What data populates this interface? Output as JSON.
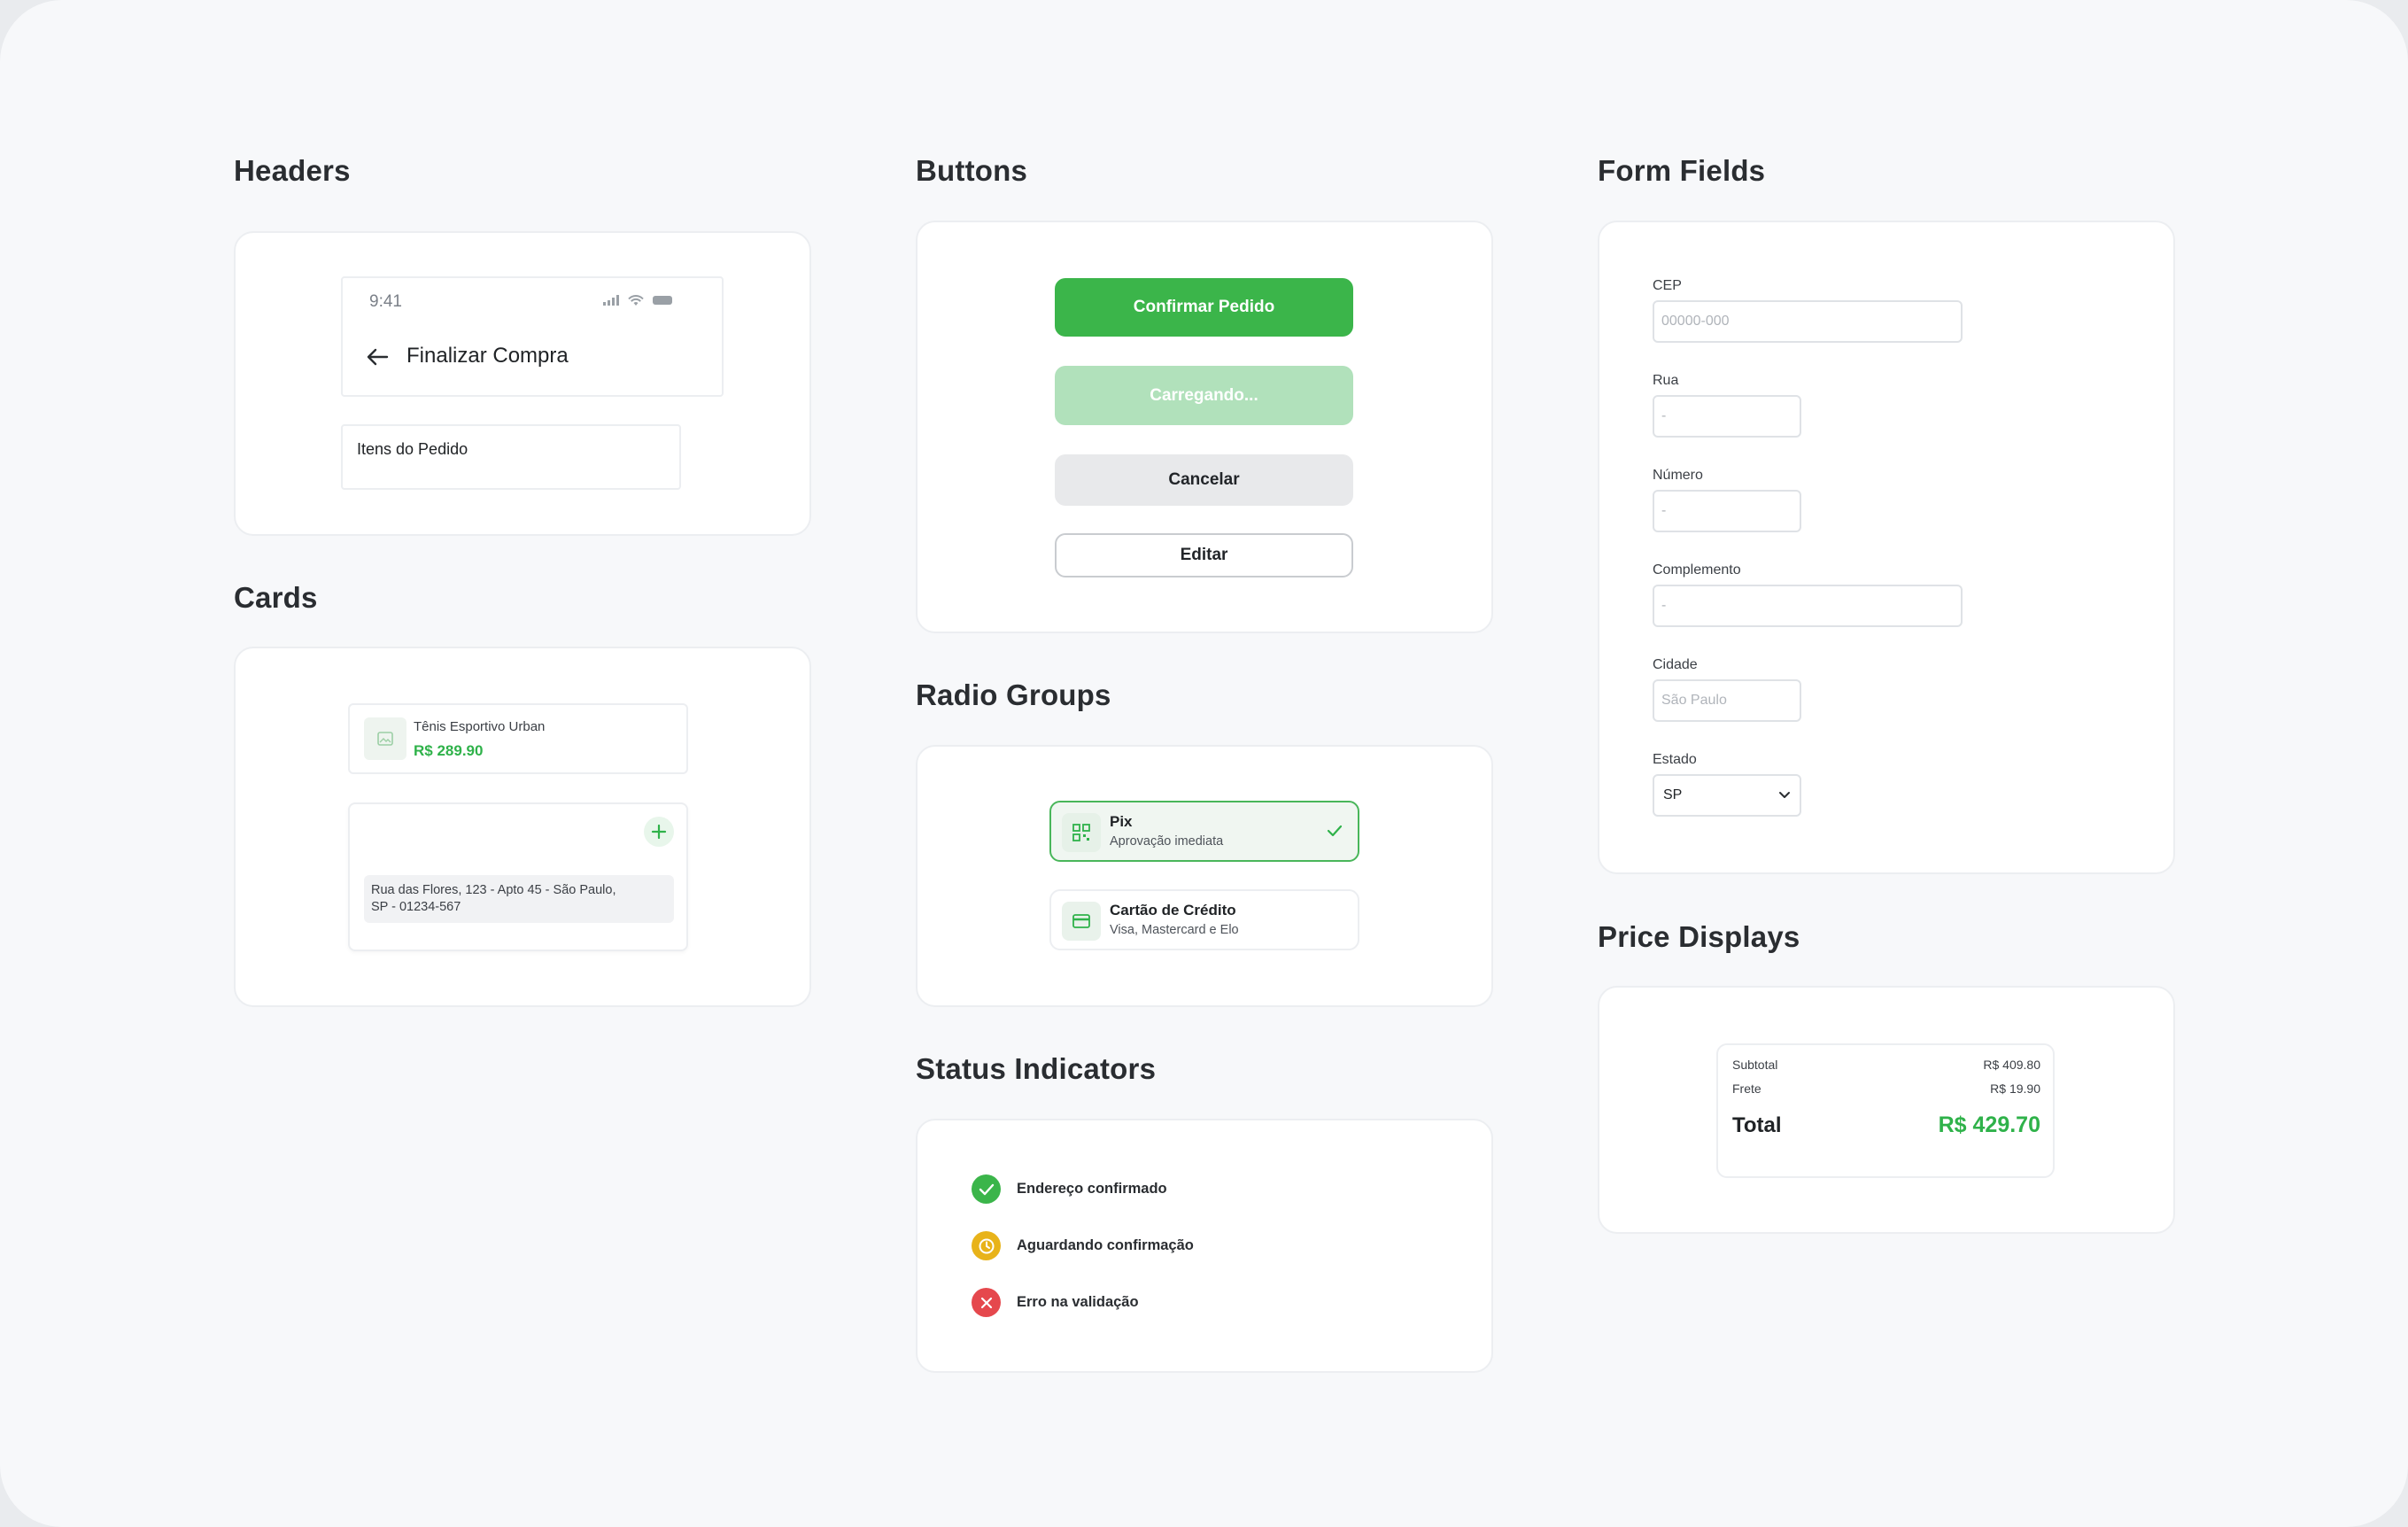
{
  "sections": {
    "headers": "Headers",
    "cards": "Cards",
    "buttons": "Buttons",
    "radio_groups": "Radio Groups",
    "status_indicators": "Status Indicators",
    "form_fields": "Form Fields",
    "price_displays": "Price Displays"
  },
  "header_demo": {
    "time": "9:41",
    "title": "Finalizar Compra",
    "items_header": "Itens do Pedido",
    "icons": [
      "signal-icon",
      "wifi-icon",
      "battery-icon",
      "back-arrow-icon"
    ]
  },
  "cards_demo": {
    "product_name": "Tênis Esportivo Urban",
    "product_price": "R$ 289.90",
    "address_line1": "Rua das Flores, 123 - Apto 45 - São Paulo,",
    "address_line2": "SP - 01234-567",
    "icons": [
      "image-placeholder-icon",
      "plus-icon"
    ]
  },
  "buttons_demo": {
    "primary": "Confirmar Pedido",
    "loading": "Carregando...",
    "cancel": "Cancelar",
    "edit": "Editar"
  },
  "radio_demo": {
    "options": [
      {
        "title": "Pix",
        "subtitle": "Aprovação imediata",
        "selected": true,
        "icon": "qr-code-icon"
      },
      {
        "title": "Cartão de Crédito",
        "subtitle": "Visa, Mastercard e Elo",
        "selected": false,
        "icon": "credit-card-icon"
      }
    ]
  },
  "status_demo": {
    "items": [
      {
        "label": "Endereço confirmado",
        "icon": "check-circle-icon",
        "color": "#3bb54a"
      },
      {
        "label": "Aguardando confirmação",
        "icon": "clock-icon",
        "color": "#e8b31a"
      },
      {
        "label": "Erro na validação",
        "icon": "x-circle-icon",
        "color": "#e5484d"
      }
    ]
  },
  "form_demo": {
    "cep": {
      "label": "CEP",
      "placeholder": "00000-000"
    },
    "rua": {
      "label": "Rua",
      "placeholder": "-"
    },
    "numero": {
      "label": "Número",
      "placeholder": "-"
    },
    "complemento": {
      "label": "Complemento",
      "placeholder": "-"
    },
    "cidade": {
      "label": "Cidade",
      "placeholder": "São Paulo"
    },
    "estado": {
      "label": "Estado",
      "value": "SP"
    }
  },
  "price_demo": {
    "subtotal_label": "Subtotal",
    "subtotal_value": "R$ 409.80",
    "frete_label": "Frete",
    "frete_value": "R$ 19.90",
    "total_label": "Total",
    "total_value": "R$ 429.70"
  },
  "colors": {
    "accent": "#3bb54a",
    "accent_light": "#b1e1bb",
    "warning": "#e8b31a",
    "error": "#e5484d"
  }
}
